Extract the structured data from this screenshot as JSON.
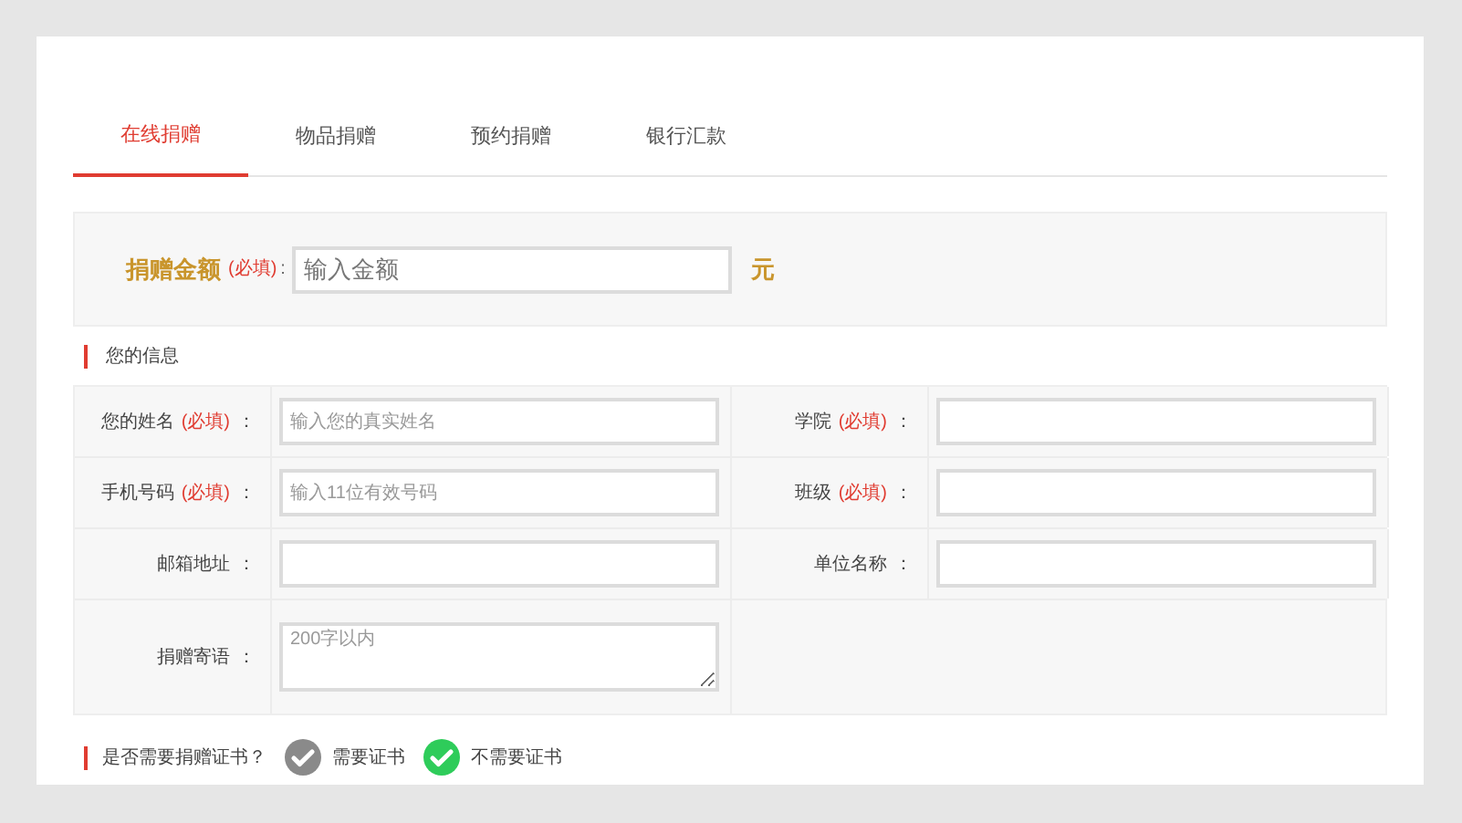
{
  "tabs": [
    {
      "label": "在线捐赠",
      "selected": true
    },
    {
      "label": "物品捐赠",
      "selected": false
    },
    {
      "label": "预约捐赠",
      "selected": false
    },
    {
      "label": "银行汇款",
      "selected": false
    }
  ],
  "amount": {
    "label": "捐赠金额",
    "required": "(必填)",
    "colon": ":",
    "placeholder": "输入金额",
    "unit": "元"
  },
  "info_section": {
    "title": "您的信息"
  },
  "fields": [
    {
      "kind": "input",
      "label": "您的姓名",
      "required": "(必填)",
      "colon": "：",
      "placeholder": "输入您的真实姓名"
    },
    {
      "kind": "input",
      "label": "学院",
      "required": "(必填)",
      "colon": "："
    },
    {
      "kind": "input",
      "label": "手机号码",
      "required": "(必填)",
      "colon": "：",
      "placeholder": "输入11位有效号码"
    },
    {
      "kind": "input",
      "label": "班级",
      "required": "(必填)",
      "colon": "："
    },
    {
      "kind": "input",
      "label": "邮箱地址",
      "colon": "："
    },
    {
      "kind": "input",
      "label": "单位名称",
      "colon": "："
    },
    {
      "kind": "textarea",
      "label": "捐赠寄语",
      "colon": "：",
      "placeholder": "200字以内"
    }
  ],
  "certificate": {
    "question": "是否需要捐赠证书？",
    "options": [
      {
        "label": "需要证书",
        "selected": false
      },
      {
        "label": "不需要证书",
        "selected": true
      }
    ]
  }
}
